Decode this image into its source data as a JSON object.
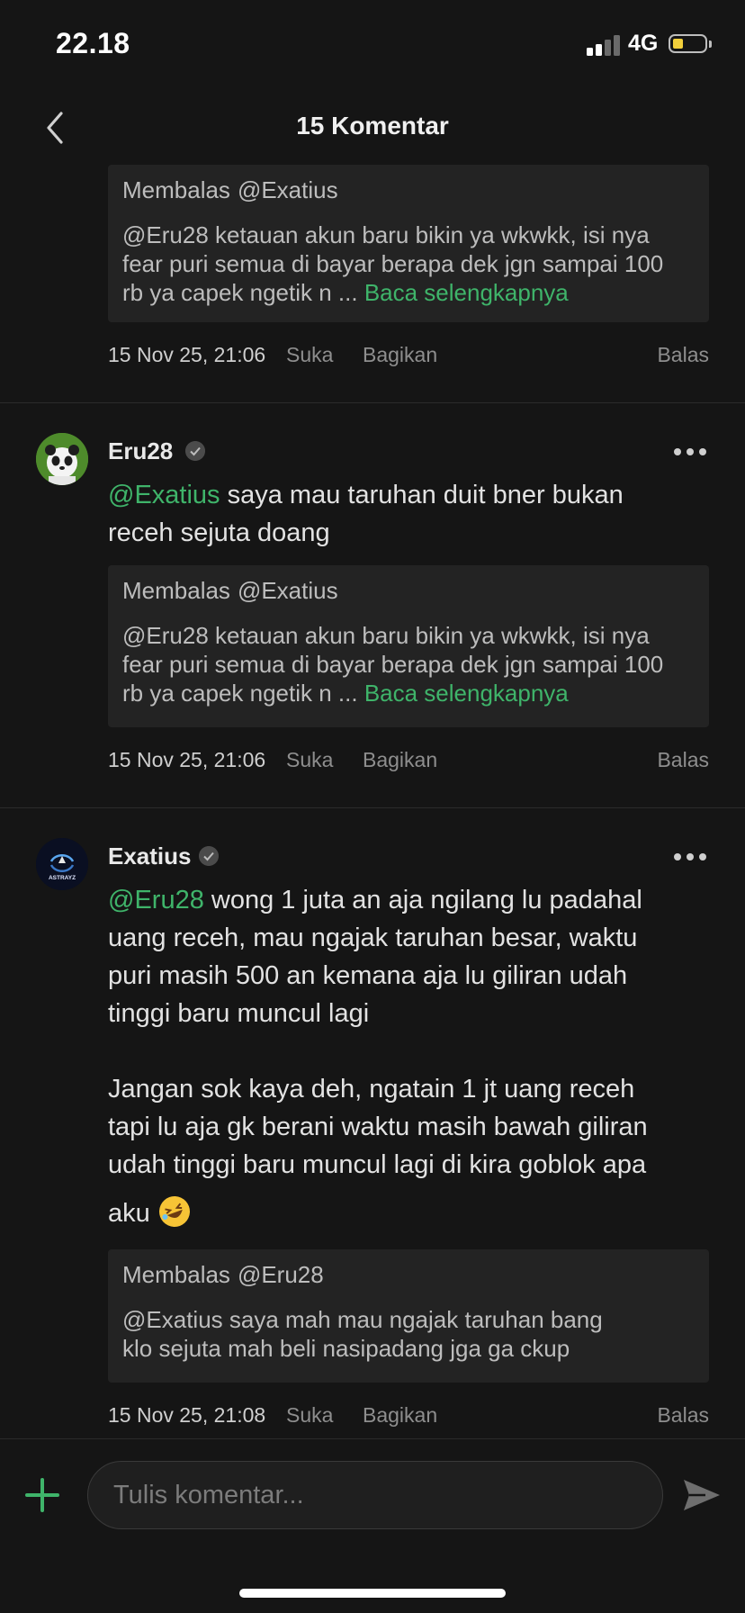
{
  "status_bar": {
    "time": "22.18",
    "network": "4G",
    "battery_level": 0.3
  },
  "header": {
    "title": "15 Komentar"
  },
  "comments": [
    {
      "quote": {
        "label": "Membalas",
        "target": "@Exatius",
        "lines": [
          "@Eru28 ketauan akun baru bikin ya wkwkk, isi nya",
          "fear puri semua di bayar berapa dek jgn sampai 100",
          "rb ya capek ngetik n ... "
        ],
        "read_more": "Baca selengkapnya"
      },
      "meta": {
        "date": "15 Nov 25, 21:06",
        "like": "Suka",
        "share": "Bagikan",
        "reply": "Balas"
      }
    },
    {
      "username": "Eru28",
      "mention": "@Exatius",
      "text_line1": " saya mau taruhan duit bner bukan",
      "text_line2": "receh sejuta doang",
      "quote": {
        "label": "Membalas",
        "target": "@Exatius",
        "lines": [
          "@Eru28 ketauan akun baru bikin ya wkwkk, isi nya",
          "fear puri semua di bayar berapa dek jgn sampai 100",
          "rb ya capek ngetik n ... "
        ],
        "read_more": "Baca selengkapnya"
      },
      "meta": {
        "date": "15 Nov 25, 21:06",
        "like": "Suka",
        "share": "Bagikan",
        "reply": "Balas"
      }
    },
    {
      "username": "Exatius",
      "avatar_text": "ASTRAYZ",
      "mention": "@Eru28",
      "text_line1": " wong 1 juta an aja ngilang lu padahal",
      "text_lines": [
        "uang receh, mau ngajak taruhan besar, waktu",
        "puri masih 500 an kemana aja lu giliran udah",
        "tinggi baru muncul lagi"
      ],
      "text_lines_2": [
        "Jangan sok kaya deh, ngatain 1 jt uang receh",
        "tapi lu aja gk berani waktu masih bawah  giliran",
        "udah tinggi baru muncul lagi di kira goblok apa"
      ],
      "text_last": "aku ",
      "quote": {
        "label": "Membalas",
        "target": "@Eru28",
        "lines": [
          "@Exatius saya mah mau ngajak taruhan bang",
          "klo sejuta mah beli nasipadang jga ga ckup"
        ]
      },
      "meta": {
        "date": "15 Nov 25, 21:08",
        "like": "Suka",
        "share": "Bagikan",
        "reply": "Balas"
      }
    }
  ],
  "input": {
    "placeholder": "Tulis komentar..."
  },
  "colors": {
    "accent": "#3fb46a",
    "background": "#151515",
    "quote_bg": "#232323"
  }
}
